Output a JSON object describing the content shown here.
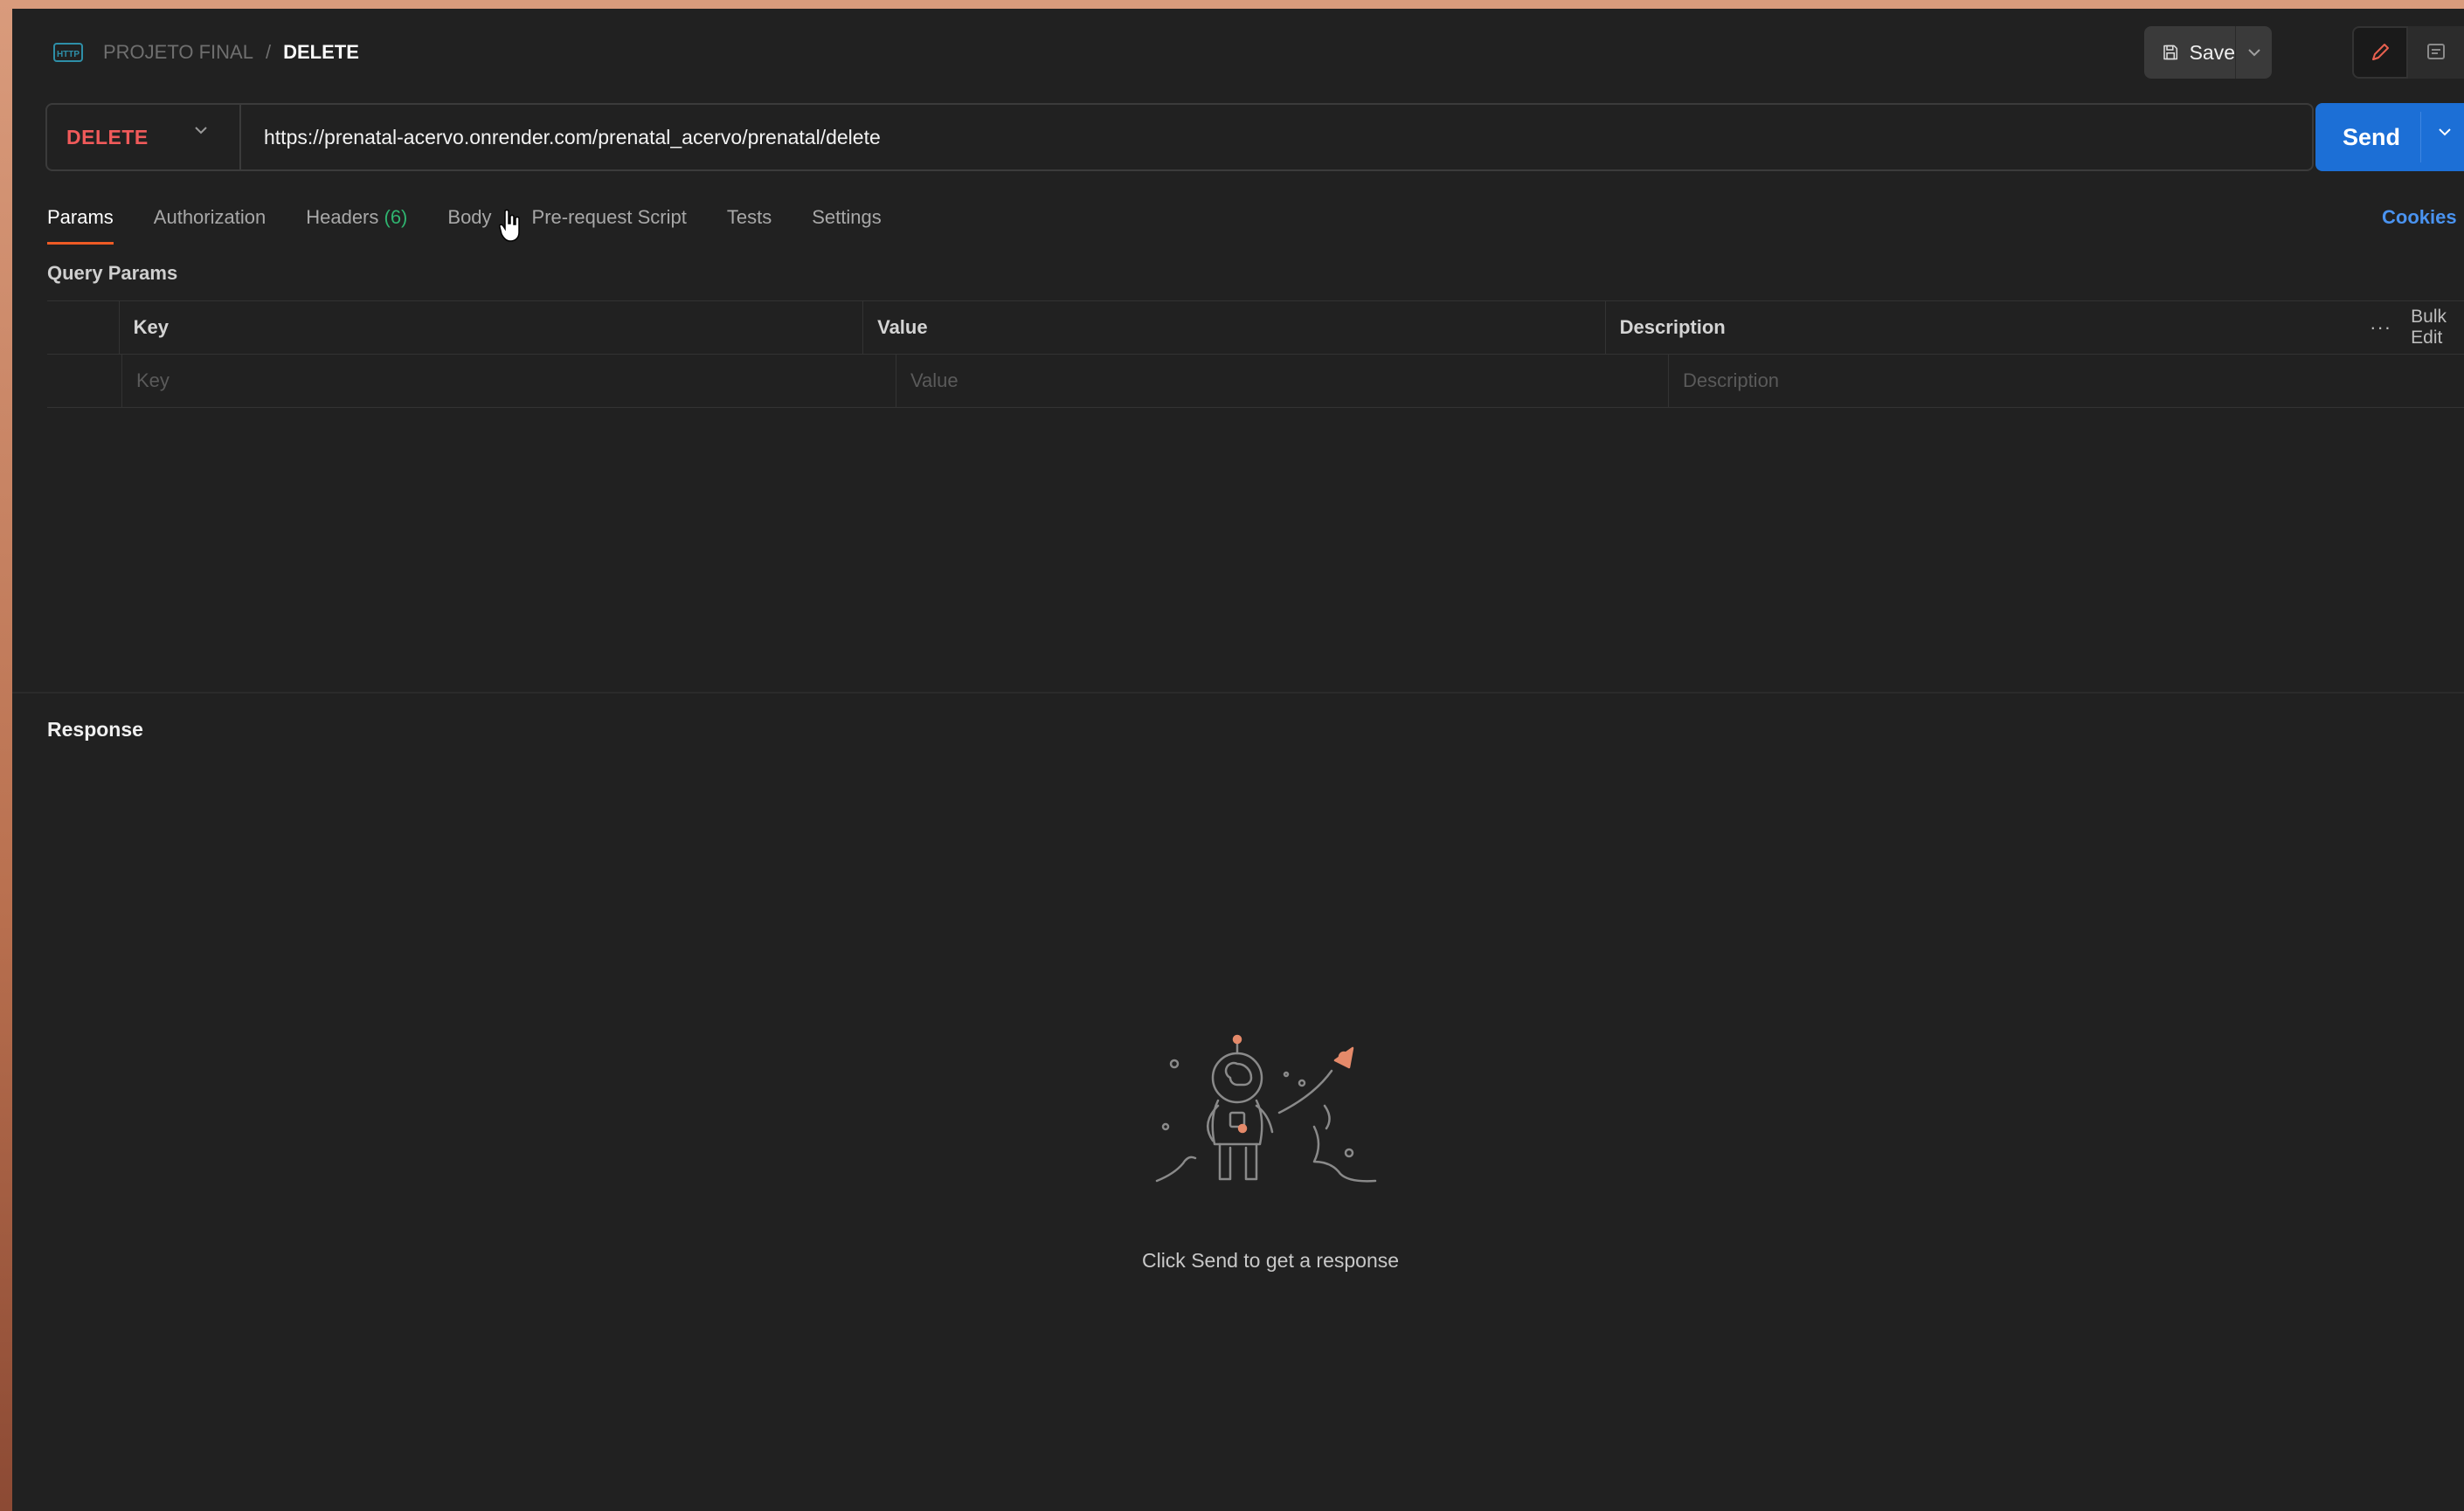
{
  "header": {
    "breadcrumb_parent": "PROJETO FINAL",
    "breadcrumb_separator": "/",
    "breadcrumb_current": "DELETE",
    "save_label": "Save"
  },
  "request": {
    "method": "DELETE",
    "url": "https://prenatal-acervo.onrender.com/prenatal_acervo/prenatal/delete",
    "send_label": "Send"
  },
  "tabs": [
    {
      "label": "Params",
      "active": true
    },
    {
      "label": "Authorization"
    },
    {
      "label": "Headers",
      "count": "(6)"
    },
    {
      "label": "Body"
    },
    {
      "label": "Pre-request Script"
    },
    {
      "label": "Tests"
    },
    {
      "label": "Settings"
    }
  ],
  "cookies_label": "Cookies",
  "query_params": {
    "title": "Query Params",
    "columns": {
      "key": "Key",
      "value": "Value",
      "description": "Description"
    },
    "placeholders": {
      "key": "Key",
      "value": "Value",
      "description": "Description"
    },
    "more_label": "···",
    "bulk_edit_label": "Bulk Edit"
  },
  "response": {
    "title": "Response",
    "empty_hint": "Click Send to get a response"
  },
  "colors": {
    "background": "#212121",
    "method_delete": "#f05a5a",
    "send_button": "#1c6fd6",
    "active_tab_underline": "#ef5b25",
    "headers_count": "#2fb36f",
    "cookies_link": "#4a93f0"
  },
  "icons": {
    "http": "http-icon",
    "save": "save-icon",
    "edit": "pencil-icon",
    "docs": "document-icon",
    "illustration": "astronaut-rocket-illustration"
  }
}
